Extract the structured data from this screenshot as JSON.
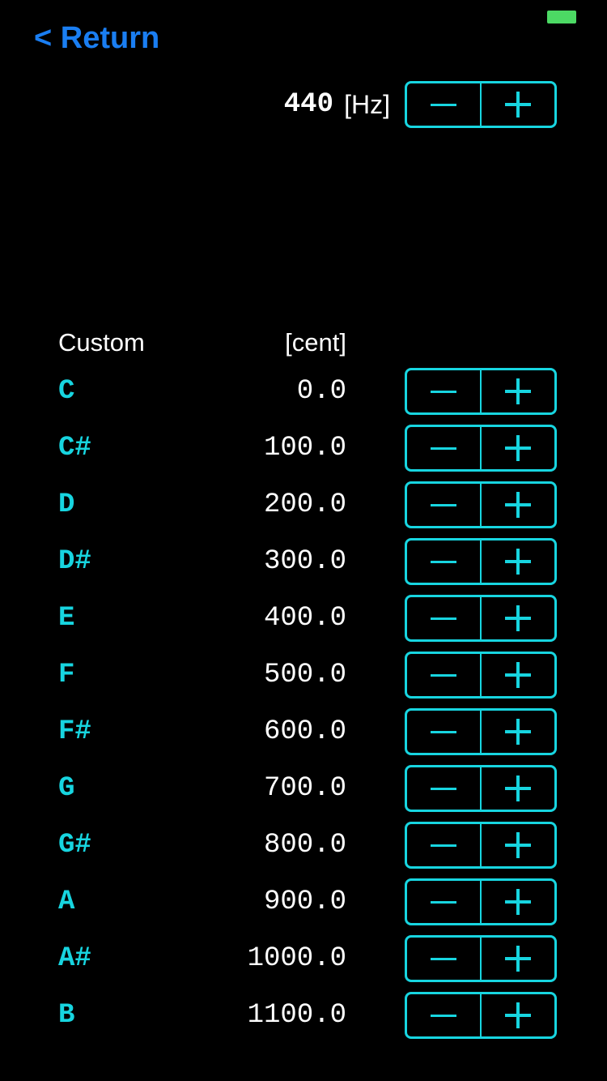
{
  "status_bar": {
    "battery_color": "#4cd964"
  },
  "nav": {
    "return_label": "< Return"
  },
  "reference": {
    "frequency_value": "440",
    "frequency_unit": "[Hz]"
  },
  "table": {
    "header_left": "Custom",
    "header_right": "[cent]",
    "rows": [
      {
        "note": "C",
        "cent": "0.0"
      },
      {
        "note": "C#",
        "cent": "100.0"
      },
      {
        "note": "D",
        "cent": "200.0"
      },
      {
        "note": "D#",
        "cent": "300.0"
      },
      {
        "note": "E",
        "cent": "400.0"
      },
      {
        "note": "F",
        "cent": "500.0"
      },
      {
        "note": "F#",
        "cent": "600.0"
      },
      {
        "note": "G",
        "cent": "700.0"
      },
      {
        "note": "G#",
        "cent": "800.0"
      },
      {
        "note": "A",
        "cent": "900.0"
      },
      {
        "note": "A#",
        "cent": "1000.0"
      },
      {
        "note": "B",
        "cent": "1100.0"
      }
    ]
  },
  "colors": {
    "background": "#000000",
    "accent_cyan": "#17d5e0",
    "link_blue": "#1a7ef2",
    "text_white": "#ffffff"
  },
  "icons": {
    "decrement": "minus-icon",
    "increment": "plus-icon"
  }
}
